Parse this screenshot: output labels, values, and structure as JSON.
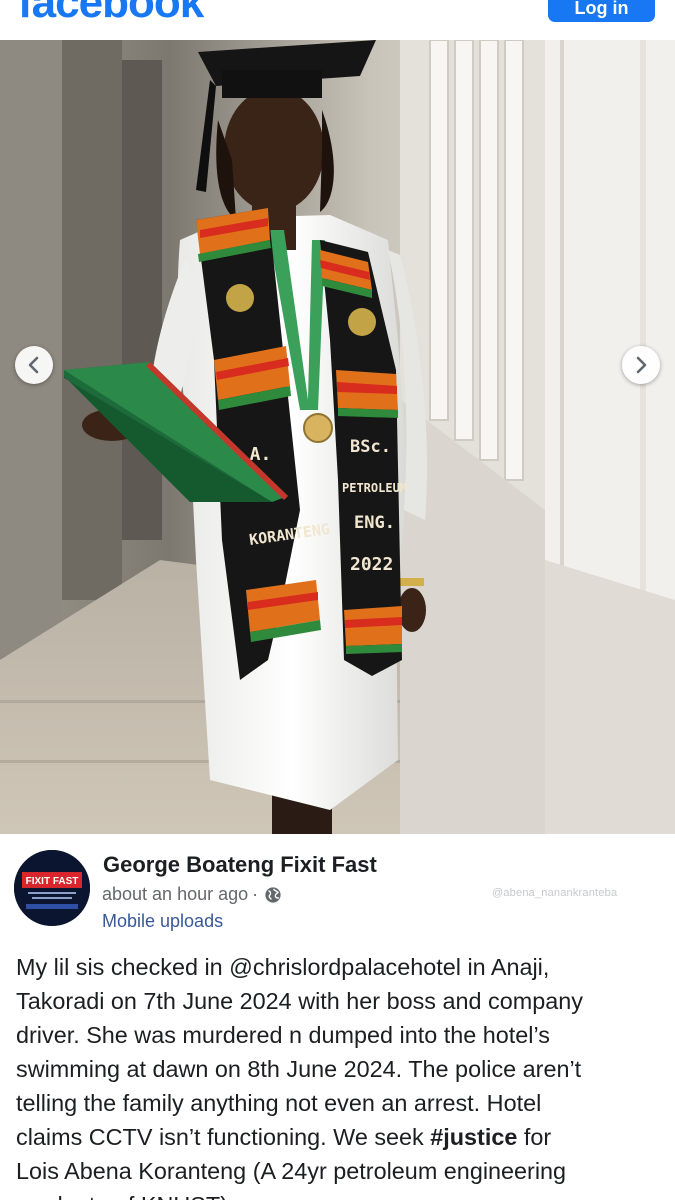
{
  "topbar": {
    "logo_text": "facebook",
    "login_label": "Log in"
  },
  "photo": {
    "stole_text": {
      "left_top": "L.A.",
      "left_bottom": "KORANTENG",
      "right_1": "BSc.",
      "right_2": "PETROLEUM",
      "right_3": "ENG.",
      "right_4": "2022"
    }
  },
  "post": {
    "author_name": "George Boateng Fixit Fast",
    "timestamp": "about an hour ago",
    "separator": "·",
    "album": "Mobile uploads",
    "watermark": "@abena_nanankranteba",
    "avatar_text": "FIXIT FAST",
    "body_lines": [
      {
        "text": "My lil sis checked in @chrislordpalacehotel in Anaji,"
      },
      {
        "text": "Takoradi on 7th June 2024 with her boss and company"
      },
      {
        "text": "driver. She was murdered n dumped into the hotel’s"
      },
      {
        "text": "swimming at dawn on 8th June 2024. The police aren’t"
      },
      {
        "text": "telling the family anything not even an arrest. Hotel"
      },
      {
        "text": "claims CCTV isn’t functioning. We seek ",
        "tag": "#justice",
        "after": " for"
      },
      {
        "text": "Lois Abena Koranteng (A 24yr petroleum engineering"
      },
      {
        "text": "graduate of KNUST)"
      }
    ]
  },
  "colors": {
    "brand_blue": "#1877f2",
    "link_blue": "#385898",
    "meta_gray": "#65676b",
    "text": "#1c1e21"
  },
  "icons": [
    "chevron-left-icon",
    "chevron-right-icon",
    "globe-icon"
  ]
}
